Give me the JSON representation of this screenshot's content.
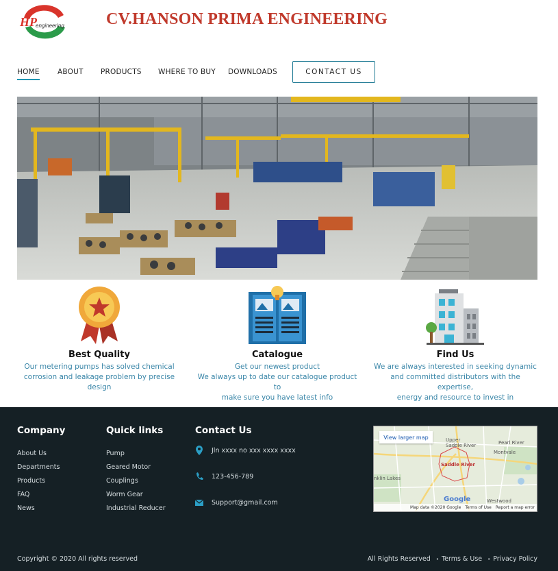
{
  "header": {
    "logo_text": "HP",
    "logo_subtext": "engineering",
    "brand": "CV.HANSON PRIMA ENGINEERING"
  },
  "nav": {
    "items": [
      "HOME",
      "ABOUT",
      "PRODUCTS",
      "WHERE TO BUY",
      "DOWNLOADS"
    ],
    "active": "HOME",
    "contact_label": "CONTACT US"
  },
  "features": [
    {
      "icon": "award-ribbon-icon",
      "title": "Best Quality",
      "lines": [
        "Our metering pumps has solved chemical",
        "corrosion and leakage problem by precise",
        "design"
      ]
    },
    {
      "icon": "catalogue-book-icon",
      "title": "Catalogue",
      "lines": [
        "Get our newest product",
        "We always up to date our catalogue product to",
        "make sure you have latest info"
      ]
    },
    {
      "icon": "building-icon",
      "title": "Find Us",
      "lines": [
        "We are always interested in seeking dynamic",
        "and committed distributors with the expertise,",
        "energy and resource to invest in"
      ]
    }
  ],
  "footer": {
    "company": {
      "title": "Company",
      "links": [
        "About Us",
        "Departments",
        "Products",
        "FAQ",
        "News"
      ]
    },
    "quick_links": {
      "title": "Quick links",
      "links": [
        "Pump",
        "Geared Motor",
        "Couplings",
        "Worm Gear",
        "Industrial Reducer"
      ]
    },
    "contact": {
      "title": "Contact Us",
      "address": "Jln xxxx no xxx xxxx xxxx",
      "phone": "123-456-789",
      "email": "Support@gmail.com"
    },
    "map": {
      "button": "View larger map",
      "place": "Saddle River",
      "labels": [
        "Upper Saddle River",
        "Pearl River",
        "Montvale",
        "Westwood",
        "nklin Lakes"
      ],
      "footer_items": [
        "Map data ©2020 Google",
        "Terms of Use",
        "Report a map error"
      ],
      "brand": "Google"
    },
    "copyright": "Copyright © 2020 All rights reserved",
    "legal": [
      "All Rights Reserved",
      "Terms & Use",
      "Privacy Policy"
    ]
  },
  "colors": {
    "brand_red": "#c0392b",
    "accent_blue": "#2196b3",
    "feature_text": "#3a86a8",
    "footer_bg": "#152025"
  }
}
